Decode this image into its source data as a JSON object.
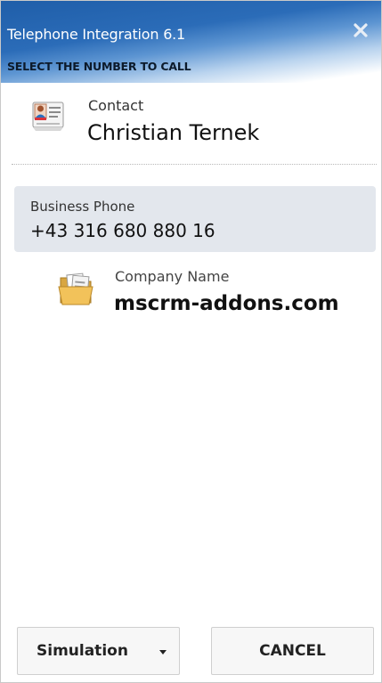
{
  "window": {
    "title": "Telephone Integration 6.1",
    "subtitle": "SELECT THE NUMBER TO CALL"
  },
  "contact": {
    "label": "Contact",
    "name": "Christian Ternek",
    "icon": "contact-card-icon"
  },
  "phone": {
    "label": "Business Phone",
    "number": "+43 316 680 880 16"
  },
  "company": {
    "label": "Company Name",
    "value": "mscrm-addons.com",
    "icon": "folder-icon"
  },
  "buttons": {
    "simulation": "Simulation",
    "cancel": "CANCEL"
  },
  "colors": {
    "header_blue": "#2b6cb8",
    "card_bg": "#e3e7ed"
  }
}
